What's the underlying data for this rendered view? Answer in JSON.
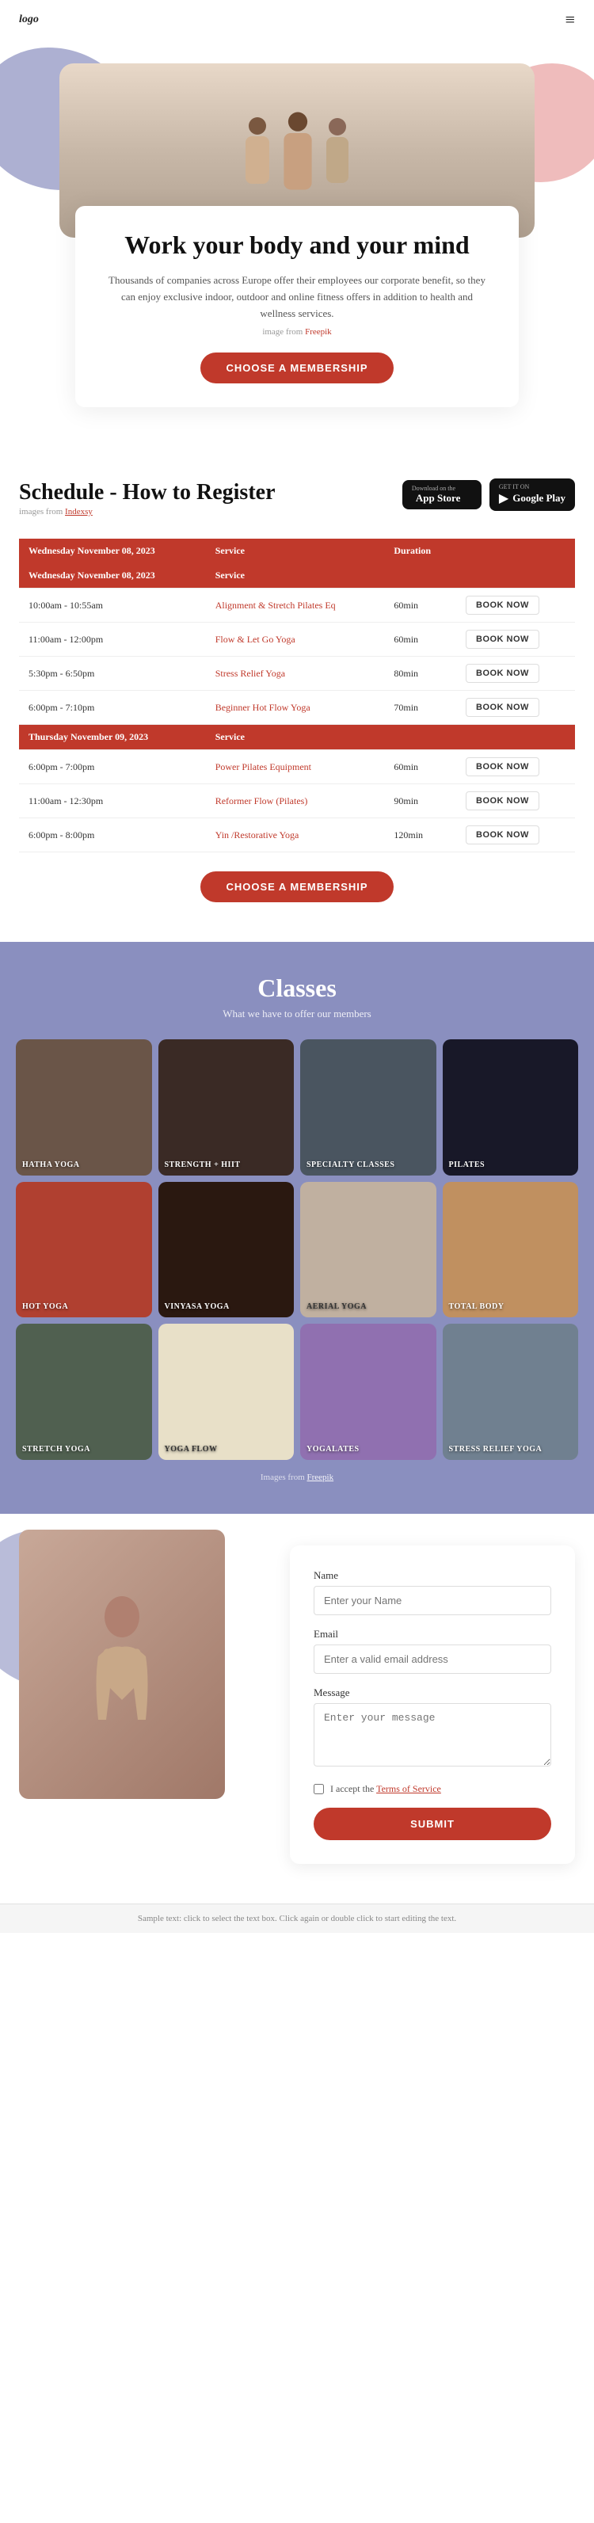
{
  "header": {
    "logo": "logo",
    "menu_icon": "≡"
  },
  "hero": {
    "title": "Work your body and your mind",
    "description": "Thousands of companies across Europe offer their employees our corporate benefit, so they can enjoy exclusive indoor, outdoor and online fitness offers in addition to health and wellness services.",
    "image_credit_text": "image from",
    "image_credit_link": "Freepik",
    "cta_button": "CHOOSE A MEMBERSHIP"
  },
  "schedule": {
    "title": "Schedule - How to Register",
    "image_credit_text": "images from",
    "image_credit_link": "Indexsy",
    "app_store": {
      "small": "Download on the",
      "large": "App Store"
    },
    "google_play": {
      "small": "GET IT ON",
      "large": "Google Play"
    },
    "days": [
      {
        "date": "Wednesday November 08, 2023",
        "classes": [
          {
            "time": "10:00am - 10:55am",
            "service": "Alignment & Stretch Pilates Eq",
            "duration": "60min"
          },
          {
            "time": "11:00am - 12:00pm",
            "service": "Flow & Let Go Yoga",
            "duration": "60min"
          },
          {
            "time": "5:30pm - 6:50pm",
            "service": "Stress Relief Yoga",
            "duration": "80min"
          },
          {
            "time": "6:00pm - 7:10pm",
            "service": "Beginner Hot Flow Yoga",
            "duration": "70min"
          }
        ]
      },
      {
        "date": "Thursday November 09, 2023",
        "classes": [
          {
            "time": "6:00pm - 7:00pm",
            "service": "Power Pilates Equipment",
            "duration": "60min"
          },
          {
            "time": "11:00am - 12:30pm",
            "service": "Reformer Flow (Pilates)",
            "duration": "90min"
          },
          {
            "time": "6:00pm - 8:00pm",
            "service": "Yin /Restorative Yoga",
            "duration": "120min"
          }
        ]
      }
    ],
    "col_headers": [
      "Service",
      "Duration"
    ],
    "book_button": "BOOK NOW",
    "cta_button": "CHOOSE A MEMBERSHIP"
  },
  "classes": {
    "title": "Classes",
    "subtitle": "What we have to offer our members",
    "items": [
      {
        "label": "HATHA YOGA",
        "color": "#6a5548"
      },
      {
        "label": "STRENGTH + HIIT",
        "color": "#3a2a25"
      },
      {
        "label": "SPECIALTY CLASSES",
        "color": "#4a5560"
      },
      {
        "label": "PILATES",
        "color": "#181828"
      },
      {
        "label": "HOT YOGA",
        "color": "#b04030"
      },
      {
        "label": "VINYASA YOGA",
        "color": "#2a1810"
      },
      {
        "label": "AERIAL YOGA",
        "color": "#c0b0a0"
      },
      {
        "label": "TOTAL BODY",
        "color": "#c09060"
      },
      {
        "label": "STRETCH YOGA",
        "color": "#506050"
      },
      {
        "label": "YOGA FLOW",
        "color": "#e8e0c8"
      },
      {
        "label": "YOGALATES",
        "color": "#9070b0"
      },
      {
        "label": "STRESS RELIEF YOGA",
        "color": "#708090"
      }
    ],
    "image_credit_text": "Images from",
    "image_credit_link": "Freepik"
  },
  "contact": {
    "form": {
      "name_label": "Name",
      "name_placeholder": "Enter your Name",
      "email_label": "Email",
      "email_placeholder": "Enter a valid email address",
      "message_label": "Message",
      "message_placeholder": "Enter your message",
      "checkbox_text": "I accept the Terms of Service",
      "terms_link": "Terms of Service",
      "submit_button": "SUBMIT"
    }
  },
  "footer": {
    "text": "Sample text: click to select the text box. Click again or double click to start editing the text."
  }
}
